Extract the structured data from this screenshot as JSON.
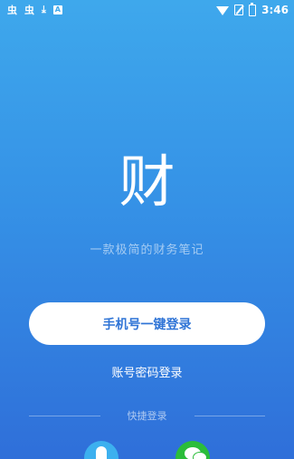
{
  "status_bar": {
    "time": "3:46",
    "left_icons": [
      "app-notification-icon",
      "app-notification-icon",
      "download-icon",
      "apk-icon"
    ],
    "right_icons": [
      "wifi-icon",
      "no-sim-icon",
      "battery-icon"
    ]
  },
  "logo": {
    "text": "财"
  },
  "tagline": "一款极简的财务笔记",
  "buttons": {
    "phone_login": "手机号一键登录",
    "password_login": "账号密码登录"
  },
  "quick_login": {
    "label": "快捷登录",
    "options": [
      "qq-icon",
      "wechat-icon"
    ]
  },
  "colors": {
    "gradient_top": "#3ea8ec",
    "gradient_bottom": "#2f6fd9",
    "button_text": "#2f74d6",
    "qq": "#3cb0ef",
    "wechat": "#2bbd3a"
  }
}
